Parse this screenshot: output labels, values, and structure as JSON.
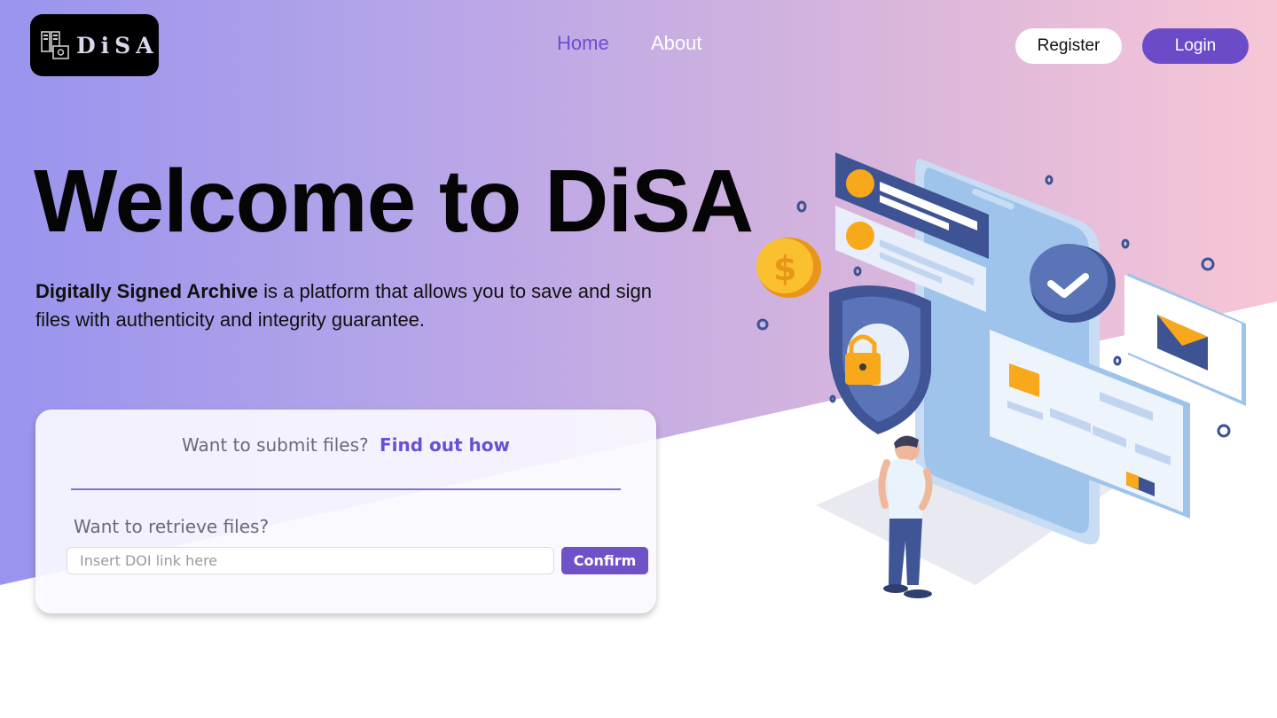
{
  "brand": {
    "logo_text": "DiSA",
    "logo_icon": "server-document-icon"
  },
  "nav": {
    "home": "Home",
    "about": "About",
    "register": "Register",
    "login": "Login"
  },
  "hero": {
    "title": "Welcome to DiSA",
    "desc_bold": "Digitally Signed Archive",
    "desc_rest": " is a platform that allows you to save and sign files with authenticity and integrity guarantee."
  },
  "card": {
    "submit_text": "Want to submit files?",
    "submit_link": "Find out how",
    "retrieve_label": "Want to retrieve files?",
    "doi_placeholder": "Insert DOI link here",
    "confirm_label": "Confirm"
  },
  "colors": {
    "accent": "#6b4fd3",
    "login_bg": "#6b4bc8",
    "confirm_bg": "#7052c8",
    "gradient_left": "#9994ee",
    "gradient_right": "#f7c6d6"
  }
}
